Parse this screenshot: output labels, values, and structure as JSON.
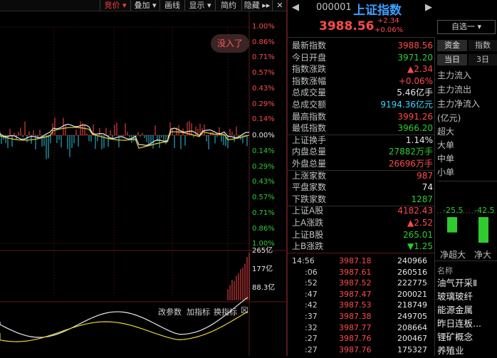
{
  "toolbar": {
    "items": [
      {
        "label": "竞价 ▾",
        "active": true
      },
      {
        "label": "叠加 ▾",
        "active": false
      },
      {
        "label": "画线",
        "active": false
      },
      {
        "label": "显示 ▾",
        "active": false
      },
      {
        "label": "简约",
        "active": false
      },
      {
        "label": "隐藏 ▸▸",
        "active": false
      }
    ]
  },
  "chart": {
    "badge": "没入了",
    "pct_up": [
      "1.00%",
      "0.86%",
      "0.71%",
      "0.57%",
      "0.43%",
      "0.29%",
      "0.14%"
    ],
    "pct_zero": "0.00%",
    "pct_down": [
      "0.14%",
      "0.29%",
      "0.43%",
      "0.57%",
      "0.71%",
      "0.86%",
      "1.00%"
    ],
    "vol_labels": [
      "265亿",
      "177亿",
      "88.3亿"
    ],
    "indicator_buttons": [
      "改参数",
      "加指标",
      "换指标"
    ],
    "close_glyph": "☒"
  },
  "header": {
    "code": "000001",
    "name": "上证指数",
    "price": "3988.56",
    "change": "+2.34",
    "change_pct": "+0.06%",
    "watch_button": "自选一 ▾"
  },
  "quote": [
    {
      "label": "最新指数",
      "value": "3988.56",
      "color": "red"
    },
    {
      "label": "今日开盘",
      "value": "3971.20",
      "color": "green"
    },
    {
      "label": "指数涨跌",
      "value": "▲2.34",
      "color": "red"
    },
    {
      "label": "指数涨幅",
      "value": "+0.06%",
      "color": "red"
    },
    {
      "label": "总成交量",
      "value": "5.46亿手",
      "color": "white"
    },
    {
      "label": "总成交额",
      "value": "9194.36亿元",
      "color": "cyan"
    },
    {
      "label": "最高指数",
      "value": "3991.26",
      "color": "red"
    },
    {
      "label": "最低指数",
      "value": "3966.20",
      "color": "green"
    },
    {
      "label": "上证换手",
      "value": "1.14%",
      "color": "white"
    },
    {
      "label": "内盘总量",
      "value": "27882万手",
      "color": "green"
    },
    {
      "label": "外盘总量",
      "value": "26696万手",
      "color": "red"
    },
    {
      "label": "上涨家数",
      "value": "987",
      "color": "red"
    },
    {
      "label": "平盘家数",
      "value": "74",
      "color": "white"
    },
    {
      "label": "下跌家数",
      "value": "1287",
      "color": "green"
    },
    {
      "label": "上证A股",
      "value": "4182.43",
      "color": "red"
    },
    {
      "label": "上A涨跌",
      "value": "▲2.52",
      "color": "red"
    },
    {
      "label": "上证B股",
      "value": "265.01",
      "color": "green"
    },
    {
      "label": "上B涨跌",
      "value": "▼1.25",
      "color": "green"
    }
  ],
  "ticks": [
    {
      "time": "14:56",
      "price": "3987.18",
      "vol": "240966"
    },
    {
      "time": ":06",
      "price": "3987.61",
      "vol": "260516"
    },
    {
      "time": ":52",
      "price": "3987.52",
      "vol": "222775"
    },
    {
      "time": ":47",
      "price": "3987.47",
      "vol": "200021"
    },
    {
      "time": ":42",
      "price": "3987.53",
      "vol": "218749"
    },
    {
      "time": ":37",
      "price": "3987.38",
      "vol": "249705"
    },
    {
      "time": ":32",
      "price": "3987.77",
      "vol": "208664"
    },
    {
      "time": ":27",
      "price": "3987.76",
      "vol": "200467"
    },
    {
      "time": ":27",
      "price": "3987.76",
      "vol": "175327"
    }
  ],
  "side": {
    "tabs": [
      "资金",
      "指数"
    ],
    "subtabs": [
      "当日",
      "3日"
    ],
    "flows": [
      "主力流入",
      "主力流出",
      "主力净流入"
    ],
    "unit": "(亿元)",
    "sizes": [
      "超大",
      "大单",
      "中单",
      "小单"
    ],
    "bar_values": [
      "-25.5",
      "-42.5"
    ],
    "bar_levels": [
      0.6,
      1.0
    ],
    "bar_labels": [
      "净超大",
      "净大"
    ],
    "list_header": "名称",
    "sectors": [
      "油气开采Ⅱ",
      "玻璃玻纤",
      "能源金属",
      "昨日连板...",
      "锂矿概念",
      "养殖业"
    ]
  }
}
